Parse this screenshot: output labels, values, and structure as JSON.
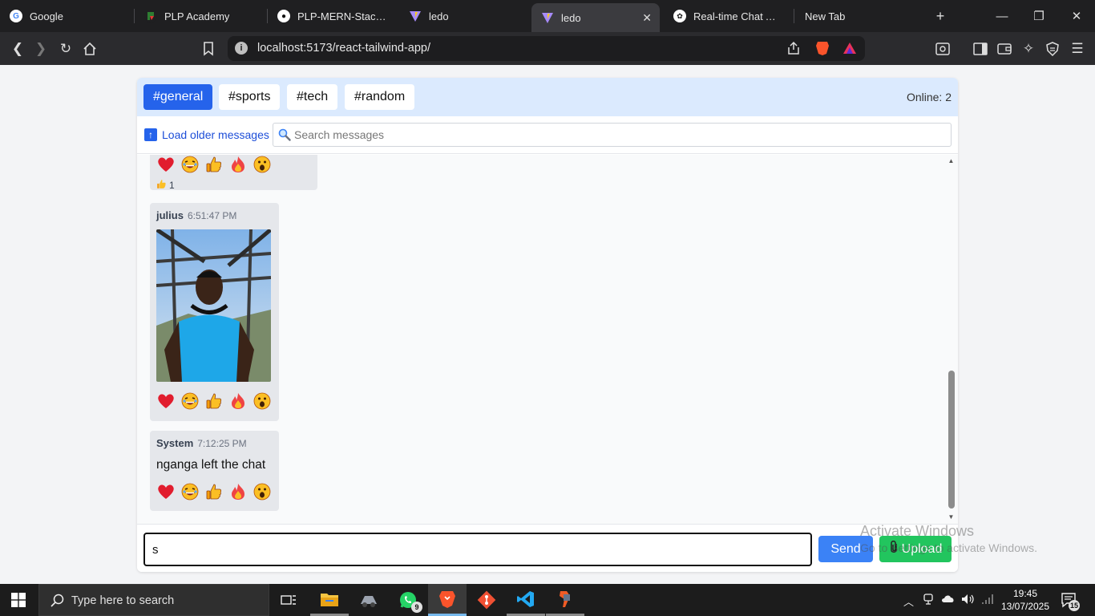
{
  "browser": {
    "tabs": [
      {
        "label": "Google",
        "icon": "google-icon"
      },
      {
        "label": "PLP Academy",
        "icon": "plp-icon"
      },
      {
        "label": "PLP-MERN-Stack-Dev",
        "icon": "github-icon"
      },
      {
        "label": "ledo",
        "icon": "vite-icon"
      },
      {
        "label": "ledo",
        "icon": "vite-icon",
        "active": true
      },
      {
        "label": "Real-time Chat App S",
        "icon": "chatgpt-icon"
      },
      {
        "label": "New Tab",
        "icon": "none"
      }
    ],
    "url": "localhost:5173/react-tailwind-app/"
  },
  "chat": {
    "rooms": [
      "#general",
      "#sports",
      "#tech",
      "#random"
    ],
    "active_room": "#general",
    "online": "Online: 2",
    "load_older": "Load older messages",
    "search_placeholder": "Search messages",
    "reaction_set": [
      "heart",
      "laughing",
      "thumbs-up",
      "fire",
      "surprised"
    ],
    "messages": [
      {
        "count": "1",
        "count_icon": "thumbs-up"
      },
      {
        "user": "julius",
        "time": "6:51:47 PM",
        "type": "image"
      },
      {
        "user": "System",
        "time": "7:12:25 PM",
        "text": "nganga left the chat"
      }
    ],
    "compose": {
      "value": "s",
      "send_label": "Send",
      "upload_label": "Upload"
    }
  },
  "watermark": {
    "line1": "Activate Windows",
    "line2": "Go to Settings to activate Windows."
  },
  "taskbar": {
    "search_placeholder": "Type here to search",
    "whatsapp_badge": "9",
    "time": "19:45",
    "date": "13/07/2025",
    "notification_count": "15"
  },
  "colors": {
    "primary": "#2563eb",
    "send": "#3b82f6",
    "upload": "#22c55e",
    "rooms_bg": "#dbeafe"
  }
}
